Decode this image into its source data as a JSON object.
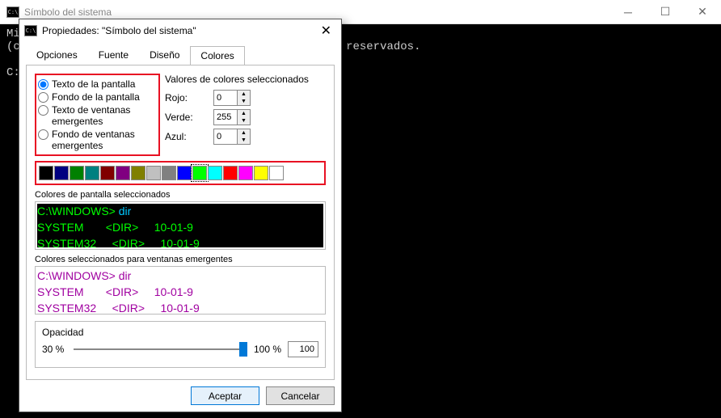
{
  "main_window": {
    "title": "Símbolo del sistema",
    "console_text": "Mi...\n(c...                                       echos reservados.\n\nC:..."
  },
  "dialog": {
    "title": "Propiedades: \"Símbolo del sistema\"",
    "tabs": [
      "Opciones",
      "Fuente",
      "Diseño",
      "Colores"
    ],
    "active_tab": "Colores",
    "radios": {
      "screen_text": "Texto de la pantalla",
      "screen_bg": "Fondo de la pantalla",
      "popup_text": "Texto de ventanas emergentes",
      "popup_bg": "Fondo de ventanas emergentes"
    },
    "values_header": "Valores de colores seleccionados",
    "values": {
      "red_label": "Rojo:",
      "red": "0",
      "green_label": "Verde:",
      "green": "255",
      "blue_label": "Azul:",
      "blue": "0"
    },
    "swatches": [
      "#000000",
      "#000080",
      "#008000",
      "#008080",
      "#800000",
      "#800080",
      "#808000",
      "#c0c0c0",
      "#808080",
      "#0000ff",
      "#00ff00",
      "#00ffff",
      "#ff0000",
      "#ff00ff",
      "#ffff00",
      "#ffffff"
    ],
    "screen_label": "Colores de pantalla seleccionados",
    "popup_label": "Colores seleccionados para ventanas emergentes",
    "preview_lines": {
      "l1a": "C:\\WINDOWS> ",
      "l1b": "dir",
      "l2": "SYSTEM       <DIR>     10-01-9",
      "l3": "SYSTEM32     <DIR>     10-01-9"
    },
    "opacity": {
      "label": "Opacidad",
      "min": "30 %",
      "max": "100 %",
      "value": "100"
    },
    "buttons": {
      "ok": "Aceptar",
      "cancel": "Cancelar"
    }
  }
}
